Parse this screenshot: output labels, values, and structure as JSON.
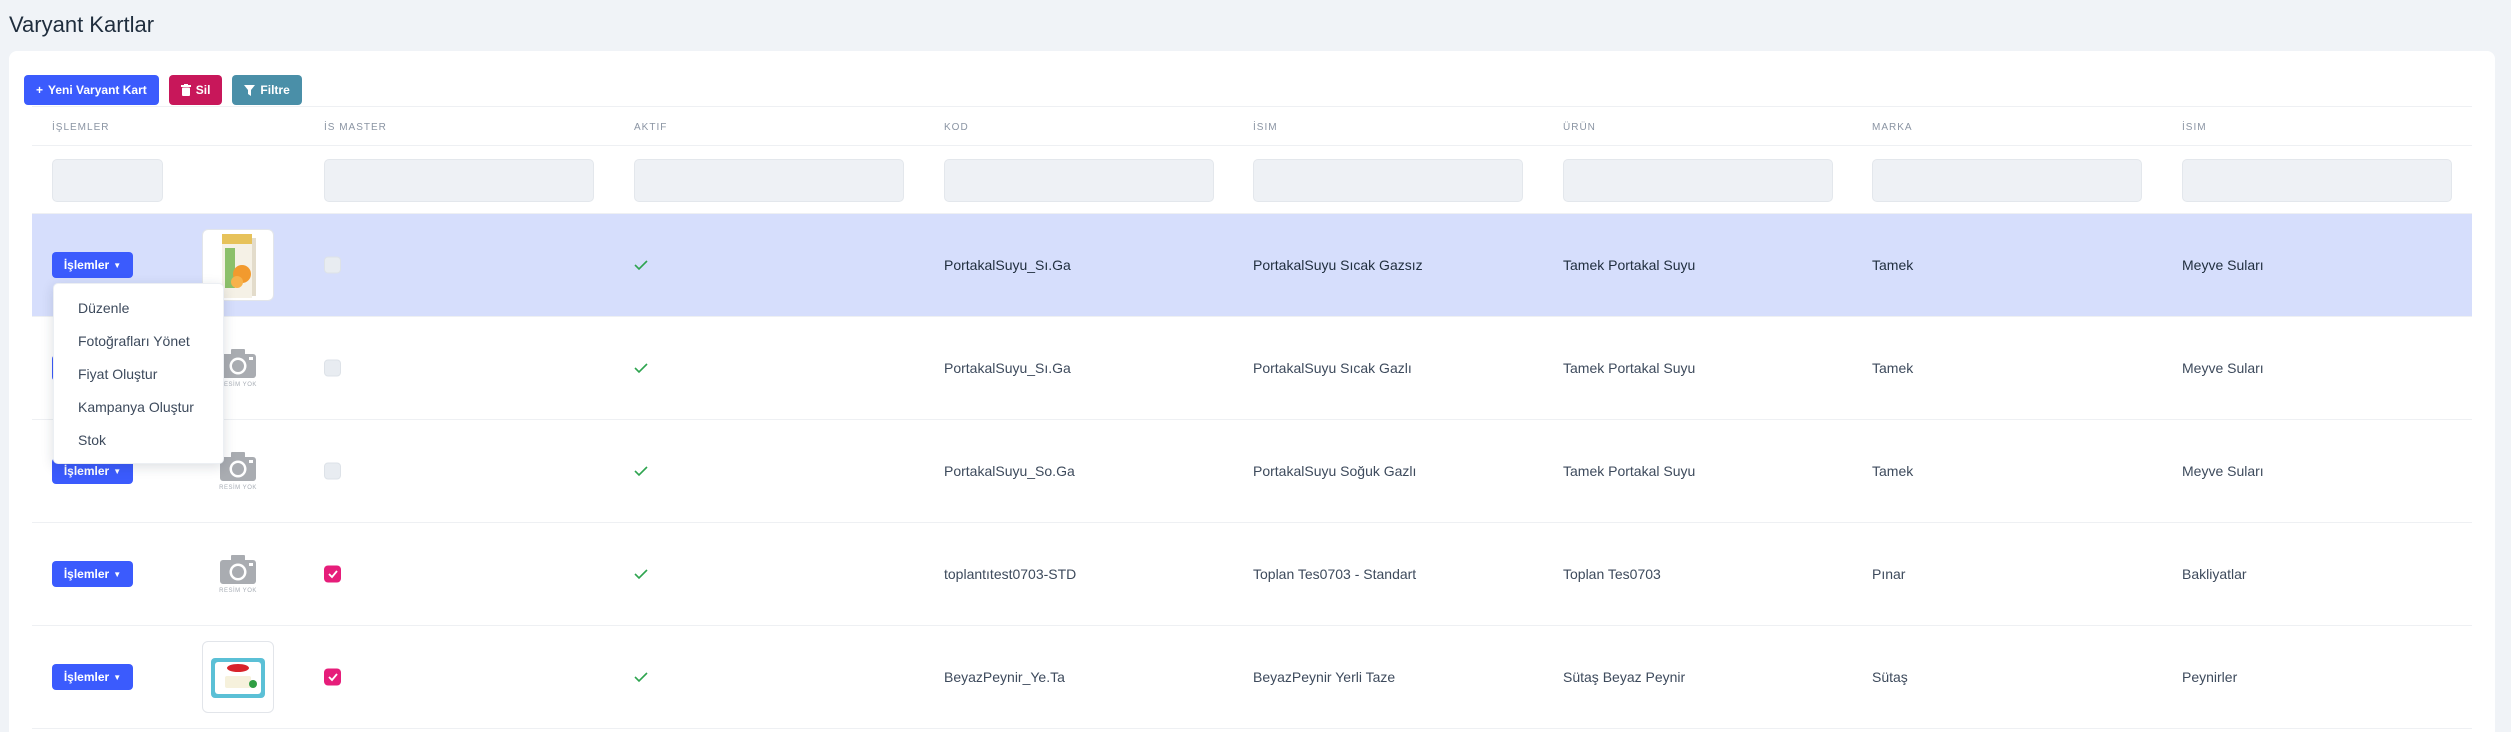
{
  "page": {
    "title": "Varyant Kartlar"
  },
  "toolbar": {
    "new_label": "Yeni Varyant Kart",
    "delete_label": "Sil",
    "filter_label": "Filtre"
  },
  "columns": [
    "İşlemler",
    "İs Master",
    "Aktif",
    "Kod",
    "İsim",
    "Ürün",
    "Marka",
    "İsim"
  ],
  "rows": [
    {
      "action": "İşlemler",
      "image": "photo-juice",
      "is_master": false,
      "active": true,
      "code": "PortakalSuyu_Sı.Ga",
      "name": "PortakalSuyu Sıcak Gazsız",
      "product": "Tamek Portakal Suyu",
      "brand": "Tamek",
      "category": "Meyve Suları",
      "selected": true
    },
    {
      "action": "İşlemler",
      "image": "no-image",
      "is_master": false,
      "active": true,
      "code": "PortakalSuyu_Sı.Ga",
      "name": "PortakalSuyu Sıcak Gazlı",
      "product": "Tamek Portakal Suyu",
      "brand": "Tamek",
      "category": "Meyve Suları",
      "selected": false
    },
    {
      "action": "İşlemler",
      "image": "no-image",
      "is_master": false,
      "active": true,
      "code": "PortakalSuyu_So.Ga",
      "name": "PortakalSuyu Soğuk Gazlı",
      "product": "Tamek Portakal Suyu",
      "brand": "Tamek",
      "category": "Meyve Suları",
      "selected": false
    },
    {
      "action": "İşlemler",
      "image": "no-image",
      "is_master": true,
      "active": true,
      "code": "toplantıtest0703-STD",
      "name": "Toplan Tes0703 - Standart",
      "product": "Toplan Tes0703",
      "brand": "Pınar",
      "category": "Bakliyatlar",
      "selected": false
    },
    {
      "action": "İşlemler",
      "image": "photo-cheese",
      "is_master": true,
      "active": true,
      "code": "BeyazPeynir_Ye.Ta",
      "name": "BeyazPeynir Yerli Taze",
      "product": "Sütaş Beyaz Peynir",
      "brand": "Sütaş",
      "category": "Peynirler",
      "selected": false
    }
  ],
  "no_image_text": "RESİM YOK",
  "dropdown": {
    "items": [
      "Düzenle",
      "Fotoğrafları Yönet",
      "Fiyat Oluştur",
      "Kampanya Oluştur",
      "Stok"
    ]
  },
  "colors": {
    "primary": "#3b5bfd",
    "danger": "#c8175a",
    "info": "#4a8fa8",
    "checked": "#e61d7a",
    "active_tick": "#2ea44f",
    "selected_row": "#d6defc"
  }
}
